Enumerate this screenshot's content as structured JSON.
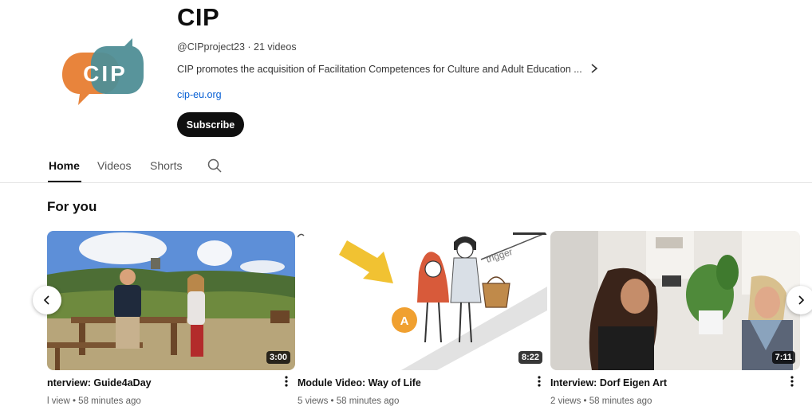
{
  "channel": {
    "name": "CIP",
    "logo_text": "CIP",
    "handle_line": "@CIPproject23 · 21 videos",
    "description": "CIP promotes the acquisition of Facilitation Competences for Culture and Adult Education ...",
    "link": "cip-eu.org",
    "subscribe_label": "Subscribe"
  },
  "tabs": [
    {
      "label": "Home",
      "active": true
    },
    {
      "label": "Videos",
      "active": false
    },
    {
      "label": "Shorts",
      "active": false
    }
  ],
  "section": {
    "title": "For you"
  },
  "videos": [
    {
      "title": "nterview: Guide4aDay",
      "meta": "l view • 58 minutes ago",
      "duration": "3:00"
    },
    {
      "title": "Module Video: Way of Life",
      "meta": "5 views • 58 minutes ago",
      "duration": "8:22"
    },
    {
      "title": "Interview: Dorf Eigen Art",
      "meta": "2 views • 58 minutes ago",
      "duration": "7:11"
    }
  ],
  "thumb2": {
    "annotation": "trigger",
    "badge": "A"
  },
  "colors": {
    "logo_orange": "#e8843c",
    "logo_teal": "#4f8e96",
    "link": "#065fd4",
    "subscribe_bg": "#0f0f0f"
  },
  "icons": [
    "search-icon",
    "chevron-right-icon",
    "more-vert-icon",
    "chevron-left-icon"
  ]
}
